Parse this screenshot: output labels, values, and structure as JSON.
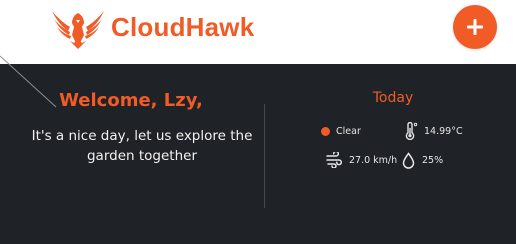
{
  "header": {
    "brand_name": "CloudHawk",
    "logo_icon": "hawk-logo-icon",
    "add_icon": "plus-icon"
  },
  "welcome": {
    "title": "Welcome, Lzy,",
    "message": "It's a nice day, let us explore the garden together"
  },
  "weather": {
    "heading": "Today",
    "condition": "Clear",
    "temperature": "14.99°C",
    "wind_speed": "27.0 km/h",
    "humidity": "25%",
    "icons": {
      "condition": "status-dot-icon",
      "temperature": "thermometer-icon",
      "wind": "wind-icon",
      "humidity": "water-drop-icon"
    }
  },
  "colors": {
    "accent": "#f05b26",
    "banner_bg": "#1f2226",
    "text_light": "#f2f2f2"
  }
}
